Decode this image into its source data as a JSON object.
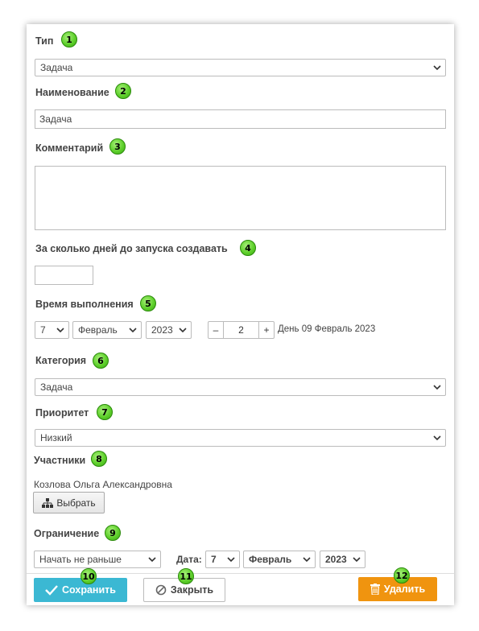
{
  "fields": {
    "type": {
      "label": "Тип",
      "badge": "1",
      "value": "Задача"
    },
    "name": {
      "label": "Наименование",
      "badge": "2",
      "value": "Задача"
    },
    "comment": {
      "label": "Комментарий",
      "badge": "3",
      "value": ""
    },
    "days_before": {
      "label": "За сколько дней до запуска создавать",
      "badge": "4",
      "value": ""
    },
    "exec_time": {
      "label": "Время выполнения",
      "badge": "5",
      "day": "7",
      "month": "Февраль",
      "year": "2023",
      "minus": "–",
      "stepper_value": "2",
      "plus": "+",
      "summary": "День 09 Февраль 2023"
    },
    "category": {
      "label": "Категория",
      "badge": "6",
      "value": "Задача"
    },
    "priority": {
      "label": "Приоритет",
      "badge": "7",
      "value": "Низкий"
    },
    "participants": {
      "label": "Участники",
      "badge": "8",
      "person": "Козлова Ольга Александровна",
      "select_button": "Выбрать"
    },
    "restriction": {
      "label": "Ограничение",
      "badge": "9",
      "mode": "Начать не раньше",
      "date_label": "Дата:",
      "day": "7",
      "month": "Февраль",
      "year": "2023"
    }
  },
  "actions": {
    "save": {
      "label": "Сохранить",
      "badge": "10"
    },
    "close": {
      "label": "Закрыть",
      "badge": "11"
    },
    "delete": {
      "label": "Удалить",
      "badge": "12"
    }
  },
  "colors": {
    "save_bg": "#3bb8d3",
    "delete_bg": "#f0940f",
    "badge_green": "#5fd02c"
  },
  "icons": {
    "chevron": "chevron-down-icon",
    "check": "check-icon",
    "forbidden": "forbidden-icon",
    "trash": "trash-icon",
    "org_tree": "org-tree-icon"
  }
}
